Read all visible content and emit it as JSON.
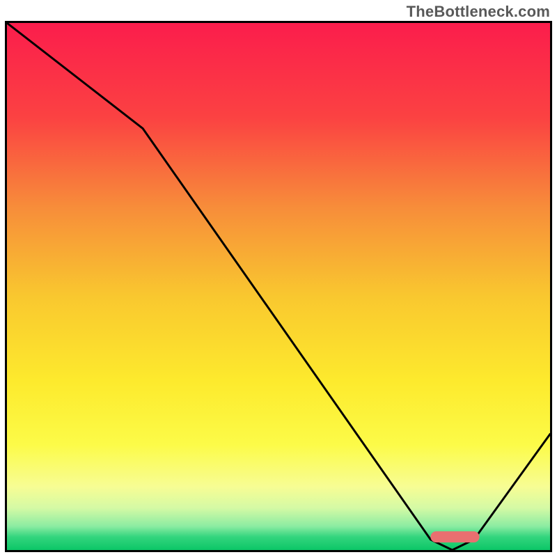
{
  "watermark": "TheBottleneck.com",
  "chart_data": {
    "type": "line",
    "title": "",
    "xlabel": "",
    "ylabel": "",
    "xlim": [
      0,
      100
    ],
    "ylim": [
      0,
      100
    ],
    "x": [
      0,
      25,
      78,
      82,
      86,
      100
    ],
    "values": [
      100,
      80,
      2,
      0,
      2,
      22
    ],
    "optimal_band_x": [
      78,
      87
    ],
    "optimal_y": 2.5,
    "background_gradient": {
      "type": "vertical",
      "stops": [
        {
          "pos": 0.0,
          "color": "#fb1d4c"
        },
        {
          "pos": 0.18,
          "color": "#fb4242"
        },
        {
          "pos": 0.35,
          "color": "#f78d3a"
        },
        {
          "pos": 0.52,
          "color": "#f9c82f"
        },
        {
          "pos": 0.68,
          "color": "#fdea2d"
        },
        {
          "pos": 0.8,
          "color": "#fcfb48"
        },
        {
          "pos": 0.88,
          "color": "#f7fd94"
        },
        {
          "pos": 0.92,
          "color": "#d5faa5"
        },
        {
          "pos": 0.955,
          "color": "#8beca2"
        },
        {
          "pos": 0.975,
          "color": "#33d57e"
        },
        {
          "pos": 1.0,
          "color": "#0cc667"
        }
      ]
    },
    "marker_color": "#e96f70",
    "line_color": "#000000"
  }
}
